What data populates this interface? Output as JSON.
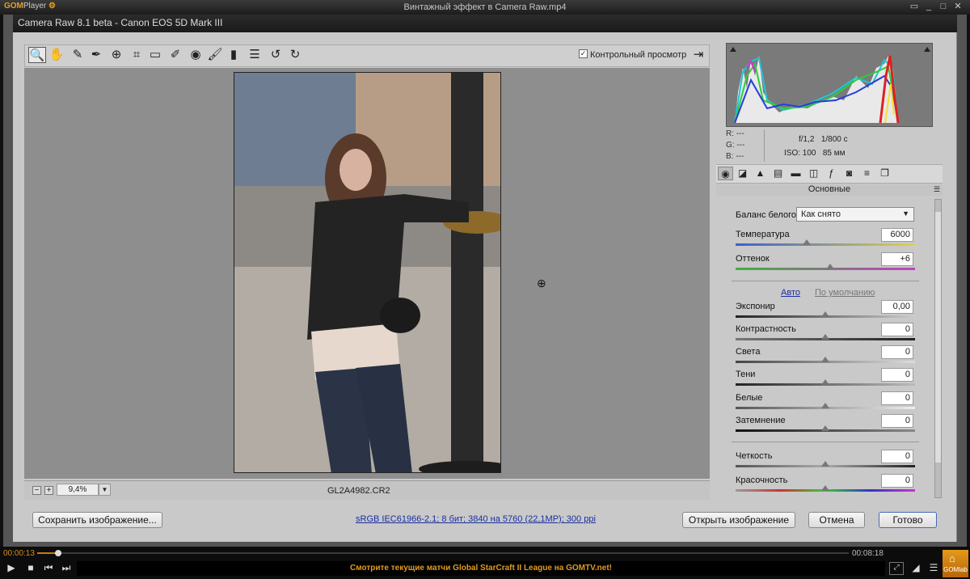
{
  "gom": {
    "logo": "GOM",
    "logo_sub": "Player",
    "file_title": "Винтажный эффект в Camera Raw.mp4",
    "time_current": "00:00:13",
    "time_total": "00:08:18",
    "progress_fraction": 0.026,
    "marquee": "Смотрите текущие матчи Global StarCraft II League на GOMTV.net!",
    "gomlab": "GOMlab",
    "accent": "#e09a20"
  },
  "cr": {
    "title": "Camera Raw 8.1 beta  -  Canon EOS 5D Mark III",
    "preview_label": "Контрольный просмотр",
    "preview_checked": "✓",
    "zoom": "9,4%",
    "filename": "GL2A4982.CR2",
    "rgb": {
      "r": "R:   ---",
      "g": "G:   ---",
      "b": "B:   ---"
    },
    "exif": {
      "aperture": "f/1,2",
      "shutter": "1/800 с",
      "iso": "ISO: 100",
      "focal": "85 мм"
    },
    "section_title": "Основные",
    "wb_label": "Баланс белого:",
    "wb_value": "Как снято",
    "auto": "Авто",
    "default": "По умолчанию",
    "sliders": [
      {
        "label": "Температура",
        "value": "6000"
      },
      {
        "label": "Оттенок",
        "value": "+6"
      },
      {
        "label": "Экспонир",
        "value": "0,00"
      },
      {
        "label": "Контрастность",
        "value": "0"
      },
      {
        "label": "Света",
        "value": "0"
      },
      {
        "label": "Тени",
        "value": "0"
      },
      {
        "label": "Белые",
        "value": "0"
      },
      {
        "label": "Затемнение",
        "value": "0"
      },
      {
        "label": "Четкость",
        "value": "0"
      },
      {
        "label": "Красочность",
        "value": "0"
      }
    ],
    "save_btn": "Сохранить изображение...",
    "info_link": "sRGB IEC61966-2.1; 8 бит; 3840 на 5760 (22,1MP); 300 ppi",
    "open_btn": "Открыть изображение",
    "cancel_btn": "Отмена",
    "done_btn": "Готово"
  }
}
